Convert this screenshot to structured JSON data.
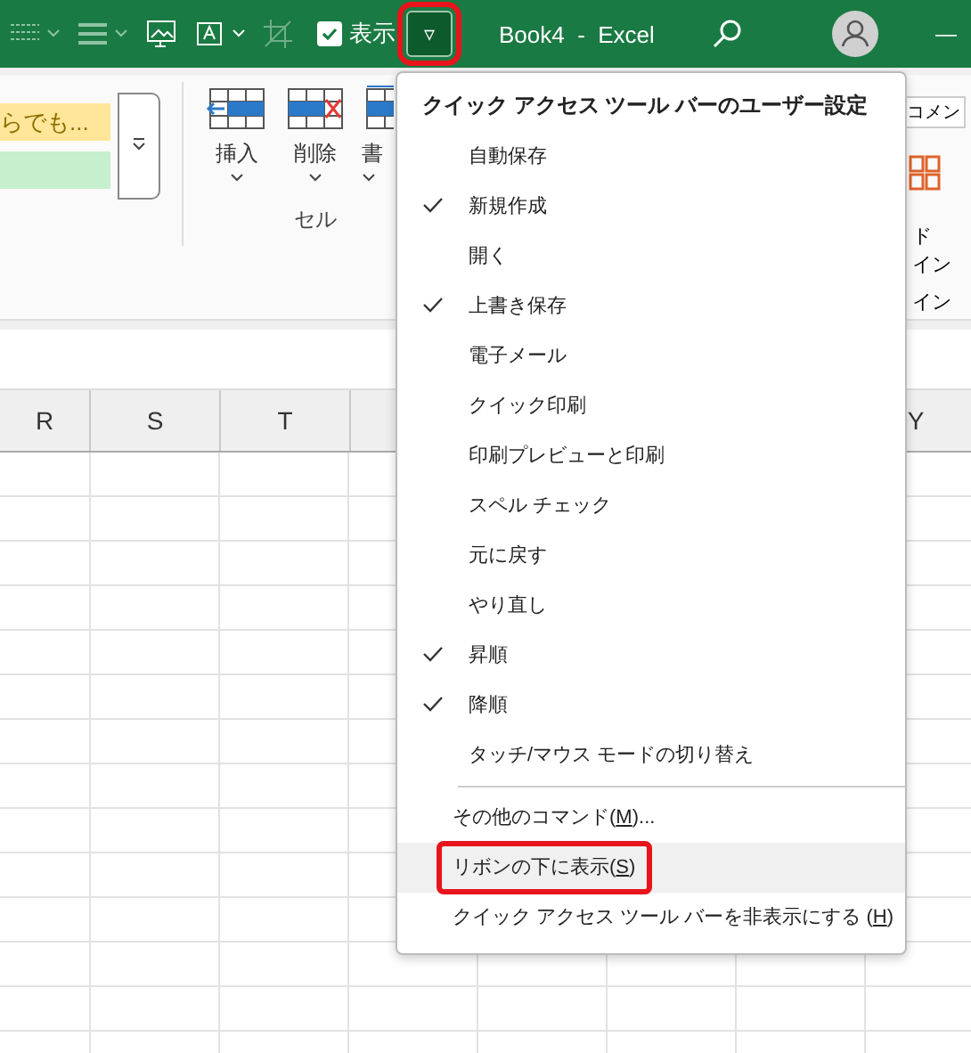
{
  "title_bar": {
    "show_label": "表示",
    "show_checked": true,
    "qat_button": {
      "glyph": "▿",
      "annotated": true
    },
    "title": "Book4  -  Excel",
    "minimize": "—"
  },
  "ribbon": {
    "style_cell": "らでも...",
    "cell_buttons": [
      {
        "label": "挿入"
      },
      {
        "label": "削除"
      },
      {
        "label": "書"
      }
    ],
    "cell_group": "セル",
    "comment_label": "コメン",
    "addin_lines": [
      "ド",
      "イン"
    ],
    "addin_group": "イン"
  },
  "columns": [
    {
      "label": "R"
    },
    {
      "label": "S"
    },
    {
      "label": "T"
    },
    {
      "label": "Y"
    }
  ],
  "menu": {
    "title": "クイック アクセス ツール バーのユーザー設定",
    "items": [
      {
        "kind": "item",
        "label": "自動保存",
        "checked": false,
        "selected": false
      },
      {
        "kind": "item",
        "label": "新規作成",
        "checked": true,
        "selected": false
      },
      {
        "kind": "item",
        "label": "開く",
        "checked": false,
        "selected": false
      },
      {
        "kind": "item",
        "label": "上書き保存",
        "checked": true,
        "selected": false
      },
      {
        "kind": "item",
        "label": "電子メール",
        "checked": false,
        "selected": false
      },
      {
        "kind": "item",
        "label": "クイック印刷",
        "checked": false,
        "selected": false
      },
      {
        "kind": "item",
        "label": "印刷プレビューと印刷",
        "checked": false,
        "selected": false
      },
      {
        "kind": "item",
        "label": "スペル チェック",
        "checked": false,
        "selected": false
      },
      {
        "kind": "item",
        "label": "元に戻す",
        "checked": false,
        "selected": false
      },
      {
        "kind": "item",
        "label": "やり直し",
        "checked": false,
        "selected": false
      },
      {
        "kind": "item",
        "label": "昇順",
        "checked": true,
        "selected": false
      },
      {
        "kind": "item",
        "label": "降順",
        "checked": true,
        "selected": false
      },
      {
        "kind": "item",
        "label": "タッチ/マウス モードの切り替え",
        "checked": false,
        "selected": false
      },
      {
        "kind": "separator"
      },
      {
        "kind": "command",
        "label": "その他のコマンド(",
        "key": "M",
        "after": ")...",
        "selected": false,
        "annotated": false
      },
      {
        "kind": "command",
        "label": "リボンの下に表示(",
        "key": "S",
        "after": ")",
        "selected": true,
        "annotated": true
      },
      {
        "kind": "command",
        "label": "クイック アクセス ツール バーを非表示にする (",
        "key": "H",
        "after": ")",
        "selected": false,
        "annotated": false
      }
    ]
  }
}
